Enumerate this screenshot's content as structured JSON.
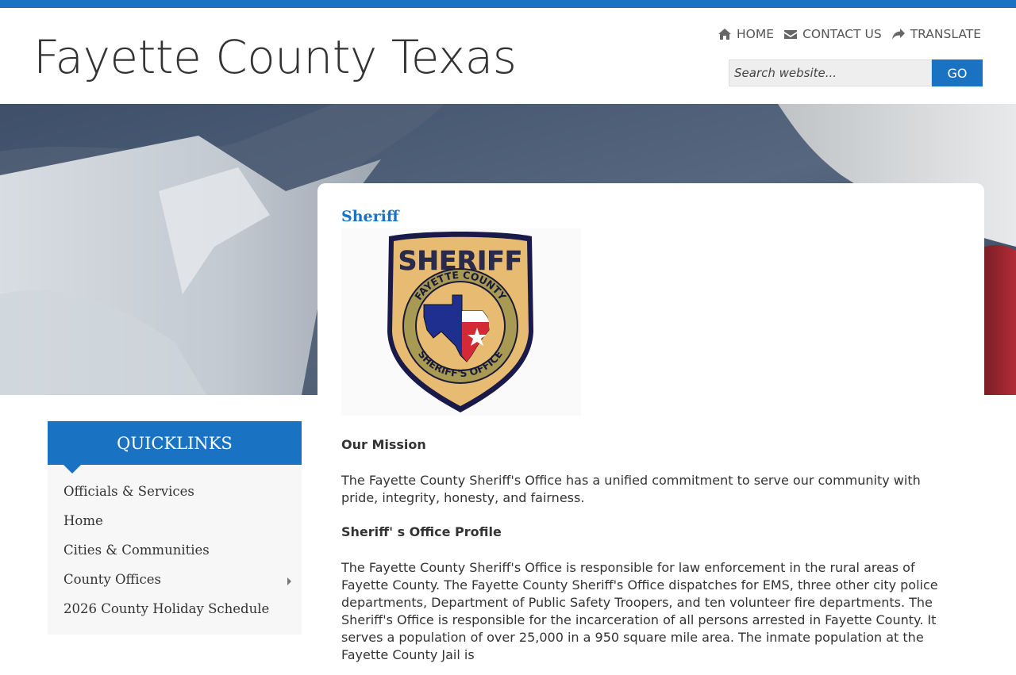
{
  "site": {
    "title": "Fayette County Texas"
  },
  "topnav": {
    "home": "HOME",
    "contact": "CONTACT US",
    "translate": "TRANSLATE"
  },
  "search": {
    "placeholder": "Search website...",
    "button": "GO"
  },
  "colors": {
    "accent": "#1a73c2"
  },
  "page": {
    "heading": "Sheriff",
    "badge": {
      "top": "SHERIFF",
      "ring_top": "FAYETTE COUNTY",
      "ring_bottom": "SHERIFF'S OFFICE"
    },
    "mission_heading": "Our Mission",
    "mission_text": "The Fayette County Sheriff's Office has a unified commitment to serve our community with pride, integrity, honesty, and fairness.",
    "profile_heading": "Sheriff' s Office Profile",
    "profile_text": "The Fayette County Sheriff's Office is responsible for law enforcement in the rural areas of Fayette County.  The Fayette County Sheriff's Office dispatches for EMS, three other city police departments, Department of Public Safety Troopers, and ten volunteer fire departments.   The Sheriff's Office is responsible for the incarceration of all persons arrested in Fayette County.  It serves a population of over 25,000 in a 950 square mile area.  The inmate population at the Fayette County Jail is"
  },
  "quicklinks": {
    "title": "QUICKLINKS",
    "items": [
      {
        "label": "Officials & Services"
      },
      {
        "label": "Home"
      },
      {
        "label": "Cities & Communities"
      },
      {
        "label": "County Offices",
        "has_submenu": true
      },
      {
        "label": "2026 County Holiday Schedule"
      }
    ]
  }
}
